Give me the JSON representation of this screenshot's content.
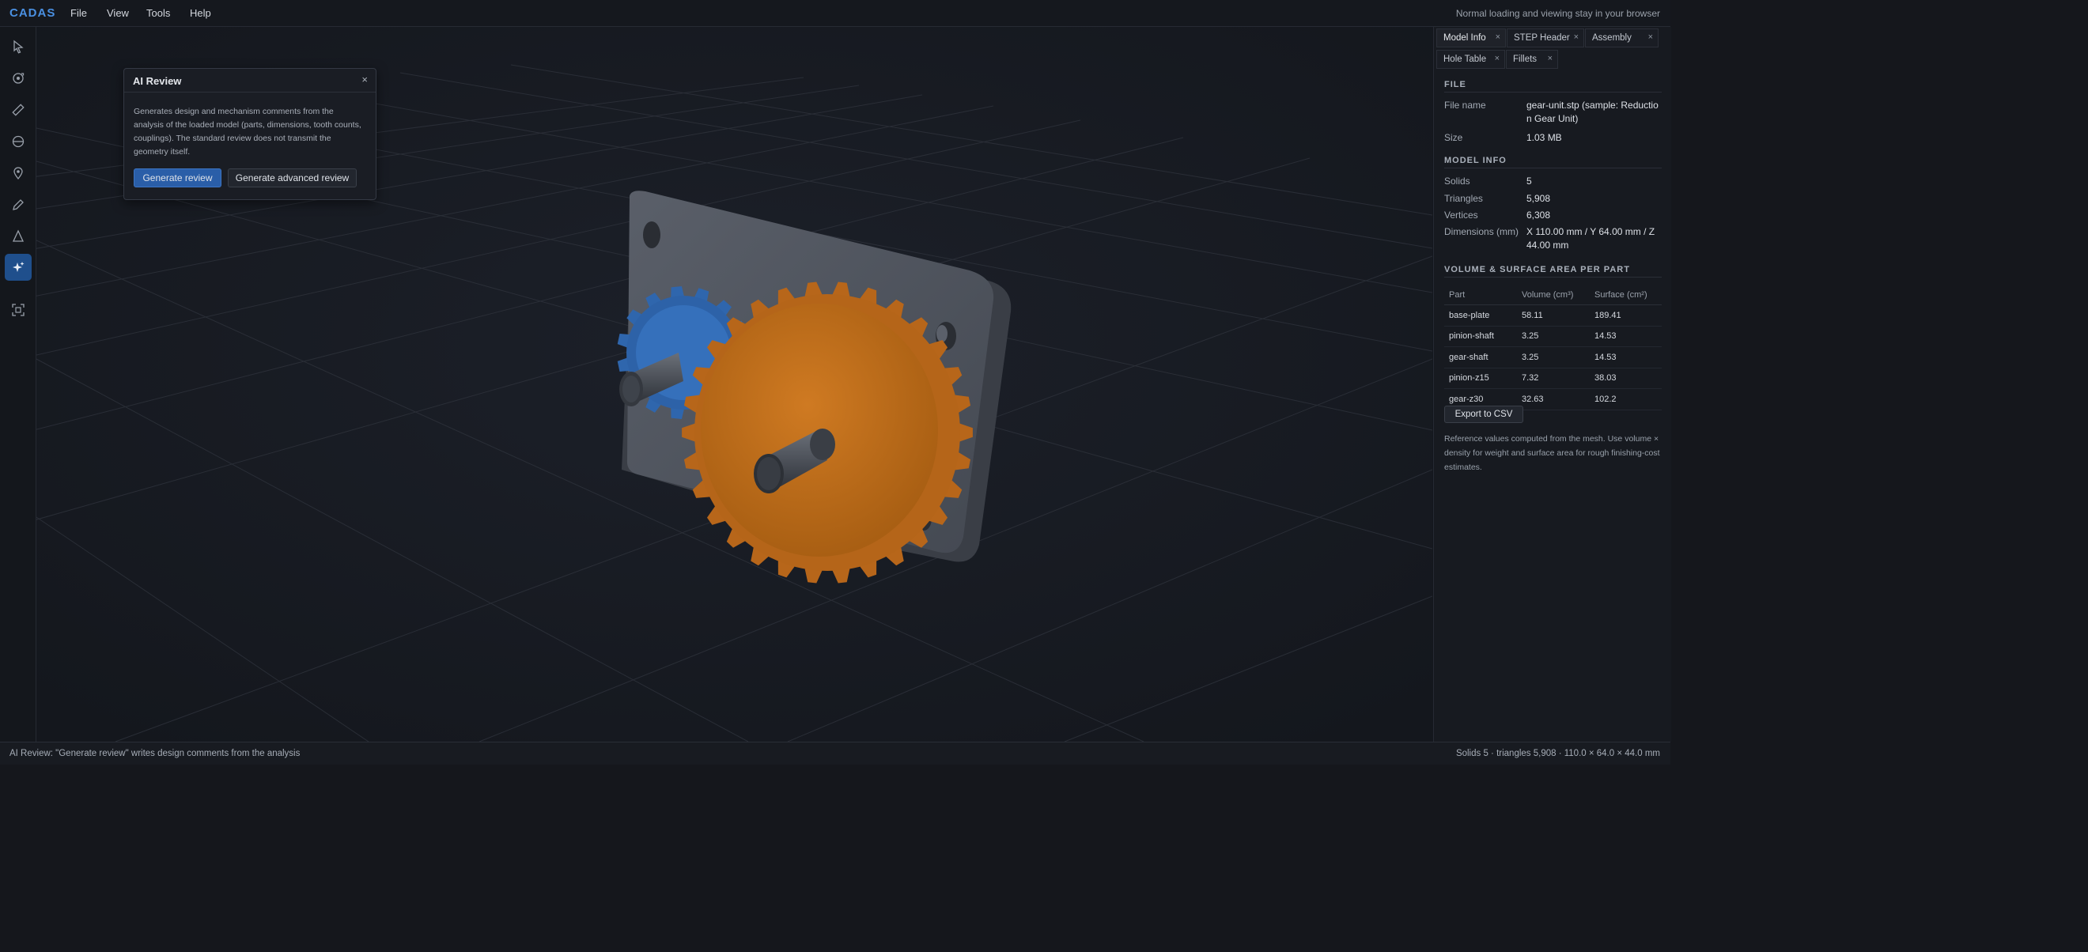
{
  "app": {
    "brand": "CADAS"
  },
  "menubar": {
    "items": [
      "File",
      "View",
      "Tools",
      "Help"
    ],
    "note": "Normal loading and viewing stay in your browser"
  },
  "toolbar": {
    "tools": [
      "select-icon",
      "orbit-icon",
      "ruler-icon",
      "section-icon",
      "pin-icon",
      "pen-icon",
      "angle-icon",
      "ai-sparkle-icon",
      "fit-view-icon"
    ],
    "active": "ai-sparkle-icon"
  },
  "ai_review": {
    "title": "AI Review",
    "close": "×",
    "description": "Generates design and mechanism comments from the analysis of the loaded model (parts, dimensions, tooth counts, couplings). The standard review does not transmit the geometry itself.",
    "generate_label": "Generate review",
    "advanced_label": "Generate advanced review"
  },
  "panel": {
    "tabs_row1": [
      {
        "label": "Model Info",
        "active": true
      },
      {
        "label": "STEP Header",
        "active": false
      },
      {
        "label": "Assembly",
        "active": false
      }
    ],
    "tabs_row2": [
      {
        "label": "Hole Table",
        "active": false
      },
      {
        "label": "Fillets",
        "active": false
      }
    ],
    "tab_close": "×",
    "file": {
      "heading": "FILE",
      "name_key": "File name",
      "name_val": "gear-unit.stp (sample: Reduction Gear Unit)",
      "size_key": "Size",
      "size_val": "1.03 MB"
    },
    "model": {
      "heading": "MODEL INFO",
      "solids_key": "Solids",
      "solids_val": "5",
      "triangles_key": "Triangles",
      "triangles_val": "5,908",
      "vertices_key": "Vertices",
      "vertices_val": "6,308",
      "dims_key": "Dimensions (mm)",
      "dims_val": "X 110.00 mm / Y 64.00 mm / Z 44.00 mm"
    },
    "parts": {
      "heading": "VOLUME & SURFACE AREA PER PART",
      "col_part": "Part",
      "col_volume": "Volume (cm³)",
      "col_surface": "Surface (cm²)",
      "rows": [
        [
          "base-plate",
          "58.11",
          "189.41"
        ],
        [
          "pinion-shaft",
          "3.25",
          "14.53"
        ],
        [
          "gear-shaft",
          "3.25",
          "14.53"
        ],
        [
          "pinion-z15",
          "7.32",
          "38.03"
        ],
        [
          "gear-z30",
          "32.63",
          "102.2"
        ]
      ]
    },
    "export_label": "Export to CSV",
    "note": "Reference values computed from the mesh. Use volume × density for weight and surface area for rough finishing-cost estimates."
  },
  "status": {
    "left": "AI Review: \"Generate review\" writes design comments from the analysis",
    "right": "Solids 5 · triangles 5,908 · 110.0 × 64.0 × 44.0 mm"
  },
  "colors": {
    "accent": "#4a90e2",
    "gear_large": "#c2701b",
    "gear_small": "#2f66ad",
    "plate": "#4e535d"
  }
}
